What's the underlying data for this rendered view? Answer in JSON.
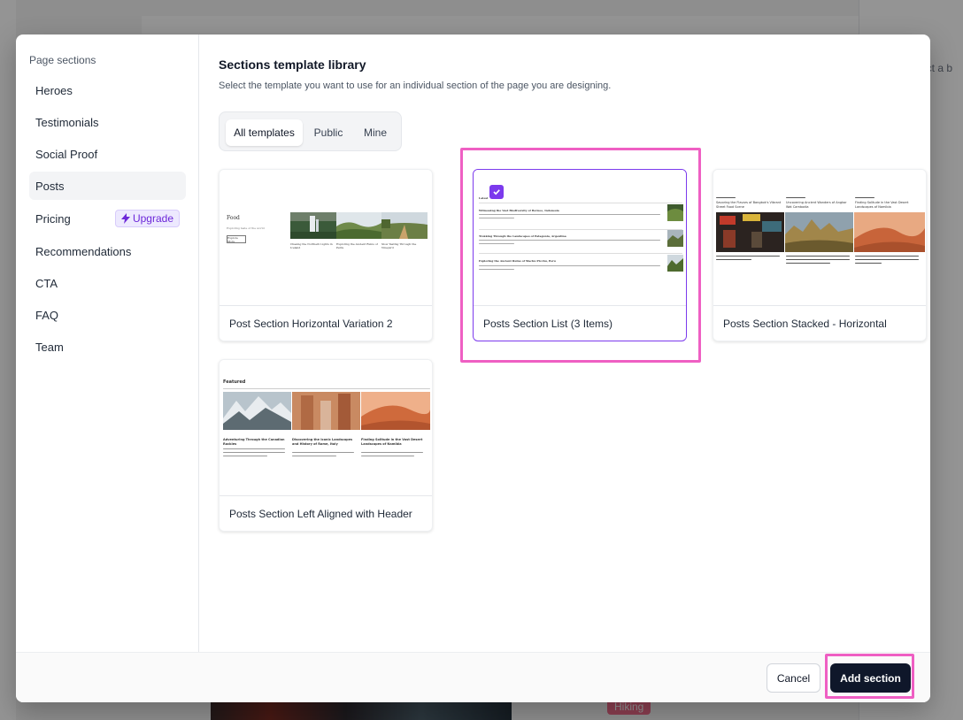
{
  "background": {
    "right_hint": "ect a b",
    "tag": "Hiking"
  },
  "sidebar": {
    "title": "Page sections",
    "items": [
      {
        "label": "Heroes"
      },
      {
        "label": "Testimonials"
      },
      {
        "label": "Social Proof"
      },
      {
        "label": "Posts",
        "active": true
      },
      {
        "label": "Pricing",
        "badge": "Upgrade"
      },
      {
        "label": "Recommendations"
      },
      {
        "label": "CTA"
      },
      {
        "label": "FAQ"
      },
      {
        "label": "Team"
      }
    ]
  },
  "library": {
    "title": "Sections template library",
    "subtitle": "Select the template you want to use for an individual section of the page you are designing.",
    "filters": [
      "All templates",
      "Public",
      "Mine"
    ],
    "active_filter": "All templates",
    "cards": [
      {
        "label": "Post Section Horizontal Variation 2",
        "selected": false
      },
      {
        "label": "Posts Section List (3 Items)",
        "selected": true
      },
      {
        "label": "Posts Section Stacked - Horizontal",
        "selected": false
      },
      {
        "label": "Posts Section Left Aligned with Header",
        "selected": false
      }
    ],
    "previews": {
      "card1": {
        "heading": "Food",
        "sub": "Exploring taste of the world",
        "button": "Explore More",
        "captions": [
          "Chasing the Northern Lights in Iceland",
          "Exploring the Ancient Ruins of Petra",
          "Slow Tasting Through the Vineyard"
        ]
      },
      "card2": {
        "heading": "Latest",
        "items": [
          "Witnessing the Vast Biodiversity of Borneo, Indonesia",
          "Trekking Through the Landscapes of Patagonia, Argentina",
          "Exploring the Ancient Ruins of Machu Picchu, Peru"
        ]
      },
      "card3": {
        "captions": [
          "Savoring the Flavors of Bangkok's Vibrant Street Food Scene",
          "Uncovering Ancient Wonders of Angkor Wat Cambodia",
          "Finding Solitude in the Vast Desert Landscapes of Namibia"
        ]
      },
      "card4": {
        "heading": "Featured",
        "captions": [
          "Adventuring Through the Canadian Rockies",
          "Discovering the Iconic Landscapes and History of Rome, Italy",
          "Finding Solitude in the Vast Desert Landscapes of Namibia"
        ]
      }
    }
  },
  "footer": {
    "cancel": "Cancel",
    "add": "Add section"
  },
  "colors": {
    "accent": "#7c3aed",
    "highlight": "#ef5fc3",
    "primary_button": "#0f172a"
  }
}
